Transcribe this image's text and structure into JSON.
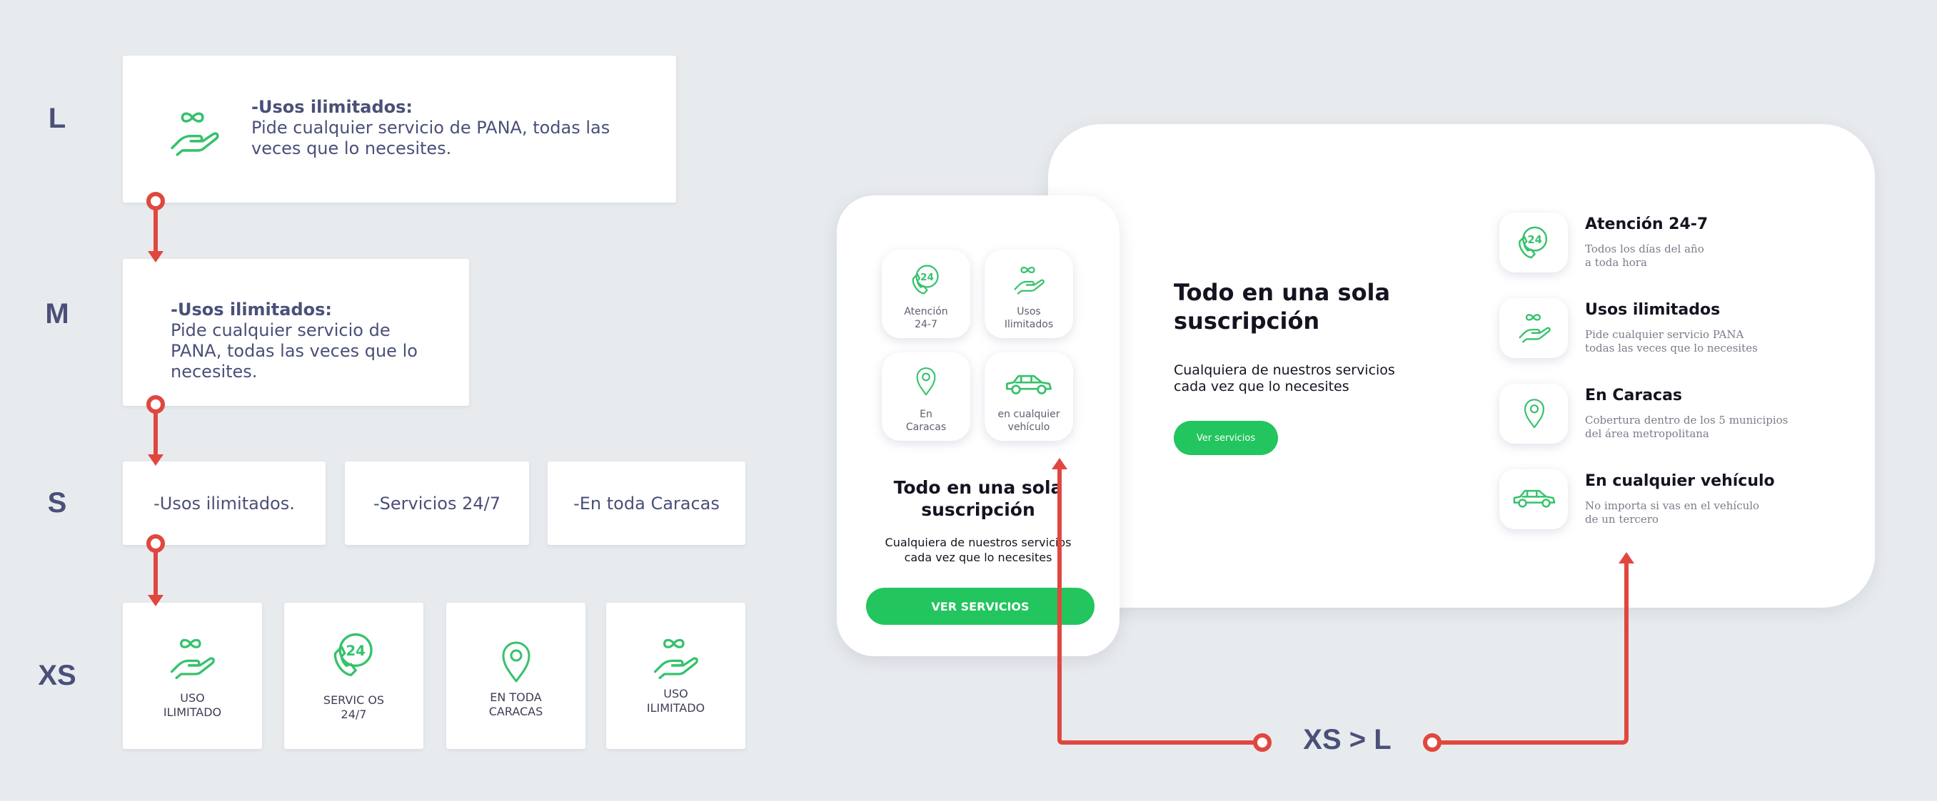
{
  "sizes": {
    "l": "L",
    "m": "M",
    "s": "S",
    "xs": "XS"
  },
  "l_card": {
    "title": "-Usos ilimitados:",
    "body": "Pide cualquier servicio de PANA, todas las veces que lo necesites.",
    "icon": "infinity-hand-icon"
  },
  "m_card": {
    "title": "-Usos ilimitados:",
    "body": "Pide cualquier servicio de PANA, todas las veces que lo necesites."
  },
  "s_cards": [
    "-Usos ilimitados.",
    "-Servicios 24/7",
    "-En toda Caracas"
  ],
  "xs_cards": [
    {
      "label": "USO\nILIMITADO",
      "icon": "infinity-hand-icon"
    },
    {
      "label": "SERVIC OS\n24/7",
      "icon": "phone-24-icon"
    },
    {
      "label": "EN TODA\nCARACAS",
      "icon": "location-pin-icon"
    },
    {
      "label": "USO\nILIMITADO",
      "icon": "infinity-hand-icon"
    }
  ],
  "mobile": {
    "tiles": [
      {
        "label": "Atención\n24-7",
        "icon": "phone-24-icon"
      },
      {
        "label": "Usos\nIlimitados",
        "icon": "infinity-hand-icon"
      },
      {
        "label": "En\nCaracas",
        "icon": "location-pin-icon"
      },
      {
        "label": "en cualquier\nvehículo",
        "icon": "car-icon"
      }
    ],
    "heading": "Todo en una sola\nsuscripción",
    "sub": "Cualquiera de nuestros servicios\ncada vez que lo necesites",
    "button": "VER SERVICIOS"
  },
  "desktop": {
    "heading": "Todo en una sola\nsuscripción",
    "sub": "Cualquiera de nuestros servicios\ncada vez que lo necesites",
    "button": "Ver servicios",
    "features": [
      {
        "title": "Atención 24-7",
        "desc": "Todos los días del año\na toda hora",
        "icon": "phone-24-icon"
      },
      {
        "title": "Usos ilimitados",
        "desc": "Pide cualquier servicio PANA\ntodas las veces que lo necesites",
        "icon": "infinity-hand-icon"
      },
      {
        "title": "En Caracas",
        "desc": "Cobertura dentro de los 5 municipios\ndel área metropolitana",
        "icon": "location-pin-icon"
      },
      {
        "title": "En cualquier vehículo",
        "desc": "No importa si vas en el vehículo\nde un tercero",
        "icon": "car-icon"
      }
    ]
  },
  "transition_label": "XS > L",
  "colors": {
    "accent_green": "#22c55e",
    "arrow_red": "#e0473f",
    "text_navy": "#4a5078",
    "background": "#e8ebee"
  }
}
